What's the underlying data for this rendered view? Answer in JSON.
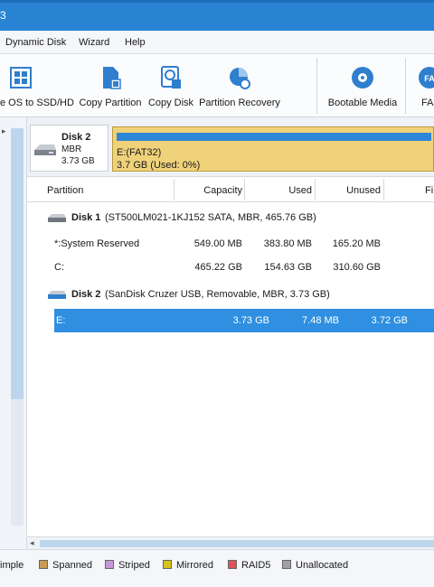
{
  "window": {
    "title_fragment": "3"
  },
  "menu": [
    "Dynamic Disk",
    "Wizard",
    "Help"
  ],
  "toolbar": [
    {
      "label": "e OS to SSD/HD",
      "icon": "migrate-os-icon"
    },
    {
      "label": "Copy Partition",
      "icon": "copy-partition-icon"
    },
    {
      "label": "Copy Disk",
      "icon": "copy-disk-icon"
    },
    {
      "label": "Partition Recovery",
      "icon": "partition-recovery-icon"
    },
    {
      "label": "Bootable Media",
      "icon": "bootable-media-icon"
    },
    {
      "label": "FA",
      "icon": "fat-icon"
    }
  ],
  "disk_map": {
    "disk_name": "Disk 2",
    "disk_type": "MBR",
    "disk_size": "3.73 GB",
    "partition_name": "E:(FAT32)",
    "partition_info": "3.7 GB (Used: 0%)",
    "used_fraction": 0.0
  },
  "table": {
    "headers": [
      "Partition",
      "Capacity",
      "Used",
      "Unused",
      "Fi"
    ],
    "disk1": {
      "name": "Disk 1",
      "desc": "(ST500LM021-1KJ152 SATA, MBR, 465.76 GB)"
    },
    "disk1_rows": [
      {
        "name": "*:System Reserved",
        "capacity": "549.00 MB",
        "used": "383.80 MB",
        "unused": "165.20 MB"
      },
      {
        "name": "C:",
        "capacity": "465.22 GB",
        "used": "154.63 GB",
        "unused": "310.60 GB"
      }
    ],
    "disk2": {
      "name": "Disk 2",
      "desc": "(SanDisk Cruzer USB, Removable, MBR, 3.73 GB)"
    },
    "disk2_rows": [
      {
        "name": "E:",
        "capacity": "3.73 GB",
        "used": "7.48 MB",
        "unused": "3.72 GB"
      }
    ]
  },
  "legend": [
    {
      "label": "imple",
      "color": "#3f7fd0"
    },
    {
      "label": "Spanned",
      "color": "#c99a52"
    },
    {
      "label": "Striped",
      "color": "#c897d8"
    },
    {
      "label": "Mirrored",
      "color": "#d8c21c"
    },
    {
      "label": "RAID5",
      "color": "#e0535b"
    },
    {
      "label": "Unallocated",
      "color": "#a0a0a0"
    }
  ],
  "colors": {
    "accent": "#2a84d4",
    "selection": "#2f8fe0",
    "partition_fat": "#efd27a"
  }
}
